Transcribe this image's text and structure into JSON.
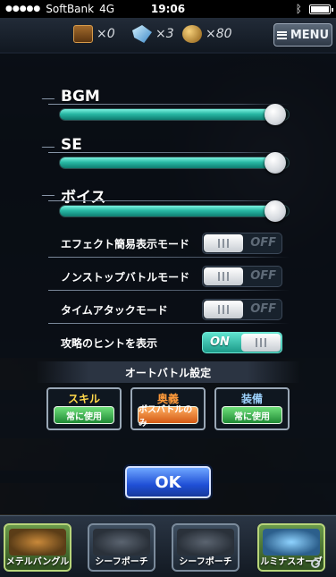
{
  "status_bar": {
    "carrier": "SoftBank",
    "network": "4G",
    "time": "19:06"
  },
  "resources": [
    {
      "icon": "treasure-chest-icon",
      "count": "×0"
    },
    {
      "icon": "crystal-icon",
      "count": "×3"
    },
    {
      "icon": "gold-orb-icon",
      "count": "×80"
    }
  ],
  "menu_label": "MENU",
  "sliders": [
    {
      "label": "BGM",
      "level": 0.94
    },
    {
      "label": "SE",
      "level": 0.94
    },
    {
      "label": "ボイス",
      "level": 0.94
    }
  ],
  "toggles": [
    {
      "label": "エフェクト簡易表示モード",
      "state": "OFF"
    },
    {
      "label": "ノンストップバトルモード",
      "state": "OFF"
    },
    {
      "label": "タイムアタックモード",
      "state": "OFF"
    },
    {
      "label": "攻略のヒントを表示",
      "state": "ON"
    }
  ],
  "auto_battle": {
    "title": "オートバトル設定",
    "options": [
      {
        "title": "スキル",
        "title_color": "#ffd84a",
        "button": "常に使用",
        "button_color": "green"
      },
      {
        "title": "奥義",
        "title_color": "#ff9a3a",
        "button": "ボスバトルのみ",
        "button_color": "orange"
      },
      {
        "title": "装備",
        "title_color": "#9fd4ff",
        "button": "常に使用",
        "button_color": "green"
      }
    ]
  },
  "ok_label": "OK",
  "bottom_items": [
    {
      "name": "メテルバングル",
      "style": "green"
    },
    {
      "name": "シーフポーチ",
      "style": "grey"
    },
    {
      "name": "シーフポーチ",
      "style": "grey"
    },
    {
      "name": "ルミナスオーブ",
      "style": "green"
    }
  ],
  "colors": {
    "accent_teal": "#28b8a4",
    "ok_blue": "#1f4fd6"
  }
}
